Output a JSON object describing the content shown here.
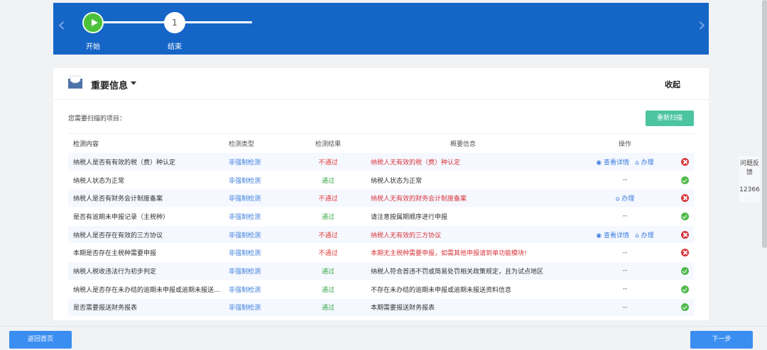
{
  "steps": [
    {
      "label": "开始",
      "state": "active",
      "icon": "play-icon"
    },
    {
      "label": "结束",
      "number": "1",
      "state": "pending"
    }
  ],
  "card": {
    "title": "重要信息",
    "collapse_label": "收起",
    "scan_label": "您需要扫描的项目：",
    "rescan_label": "重新扫描"
  },
  "table": {
    "columns": [
      "检测内容",
      "检测类型",
      "检测结果",
      "概要信息",
      "操作"
    ],
    "rows": [
      {
        "content": "纳税人是否有有效的税（费）种认定",
        "type": "非强制检测",
        "result": "不通过",
        "result_status": "fail",
        "summary": "纳税人无有效的税（费）种认定",
        "actions": [
          "查看详情",
          "办理"
        ],
        "status_icon": "error-icon"
      },
      {
        "content": "纳税人状态为正常",
        "type": "非强制检测",
        "result": "通过",
        "result_status": "pass",
        "summary": "纳税人状态为正常",
        "actions": [],
        "op_text": "--",
        "status_icon": "check-icon"
      },
      {
        "content": "纳税人是否有财务会计制度备案",
        "type": "非强制检测",
        "result": "不通过",
        "result_status": "fail",
        "summary": "纳税人无有效的财务会计制度备案",
        "actions": [
          "办理"
        ],
        "status_icon": "error-icon"
      },
      {
        "content": "是否有逾期未申报记录（主税种）",
        "type": "非强制检测",
        "result": "通过",
        "result_status": "pass",
        "summary": "请注意按属期顺序进行申报",
        "actions": [],
        "op_text": "--",
        "status_icon": "check-icon"
      },
      {
        "content": "纳税人是否存在有效的三方协议",
        "type": "非强制检测",
        "result": "不通过",
        "result_status": "fail",
        "summary": "纳税人无有效的三方协议",
        "actions": [
          "查看详情",
          "办理"
        ],
        "status_icon": "error-icon"
      },
      {
        "content": "本期是否存在主税种需要申报",
        "type": "非强制检测",
        "result": "不通过",
        "result_status": "fail",
        "summary": "本期无主税种需要申报，如需其他申报请到单功能模块!",
        "actions": [],
        "op_text": "--",
        "status_icon": "error-icon"
      },
      {
        "content": "纳税人税收违法行为初步判定",
        "type": "非强制检测",
        "result": "通过",
        "result_status": "pass",
        "summary": "纳税人符合首违不罚或简易处罚相关政策规定，且为试点地区",
        "actions": [],
        "op_text": "--",
        "status_icon": "check-icon"
      },
      {
        "content": "纳税人是否存在未办结的逾期未申报或逾期未报送...",
        "type": "非强制检测",
        "result": "通过",
        "result_status": "pass",
        "summary": "不存在未办结的逾期未申报或逾期未报送资料信息",
        "actions": [],
        "op_text": "--",
        "status_icon": "check-icon"
      },
      {
        "content": "是否需要报送财务报表",
        "type": "非强制检测",
        "result": "通过",
        "result_status": "pass",
        "summary": "本期需要报送财务报表",
        "actions": [],
        "op_text": "--",
        "status_icon": "check-icon"
      }
    ]
  },
  "feedback": {
    "title": "问题反馈",
    "number": "12366"
  },
  "buttons": {
    "home": "返回首页",
    "next": "下一步"
  },
  "colors": {
    "banner": "#1565c7",
    "pass": "#3aa84a",
    "fail": "#e23a3a",
    "link": "#3b7ddd",
    "rescan": "#4cc4a0",
    "button": "#3b8ef1"
  }
}
